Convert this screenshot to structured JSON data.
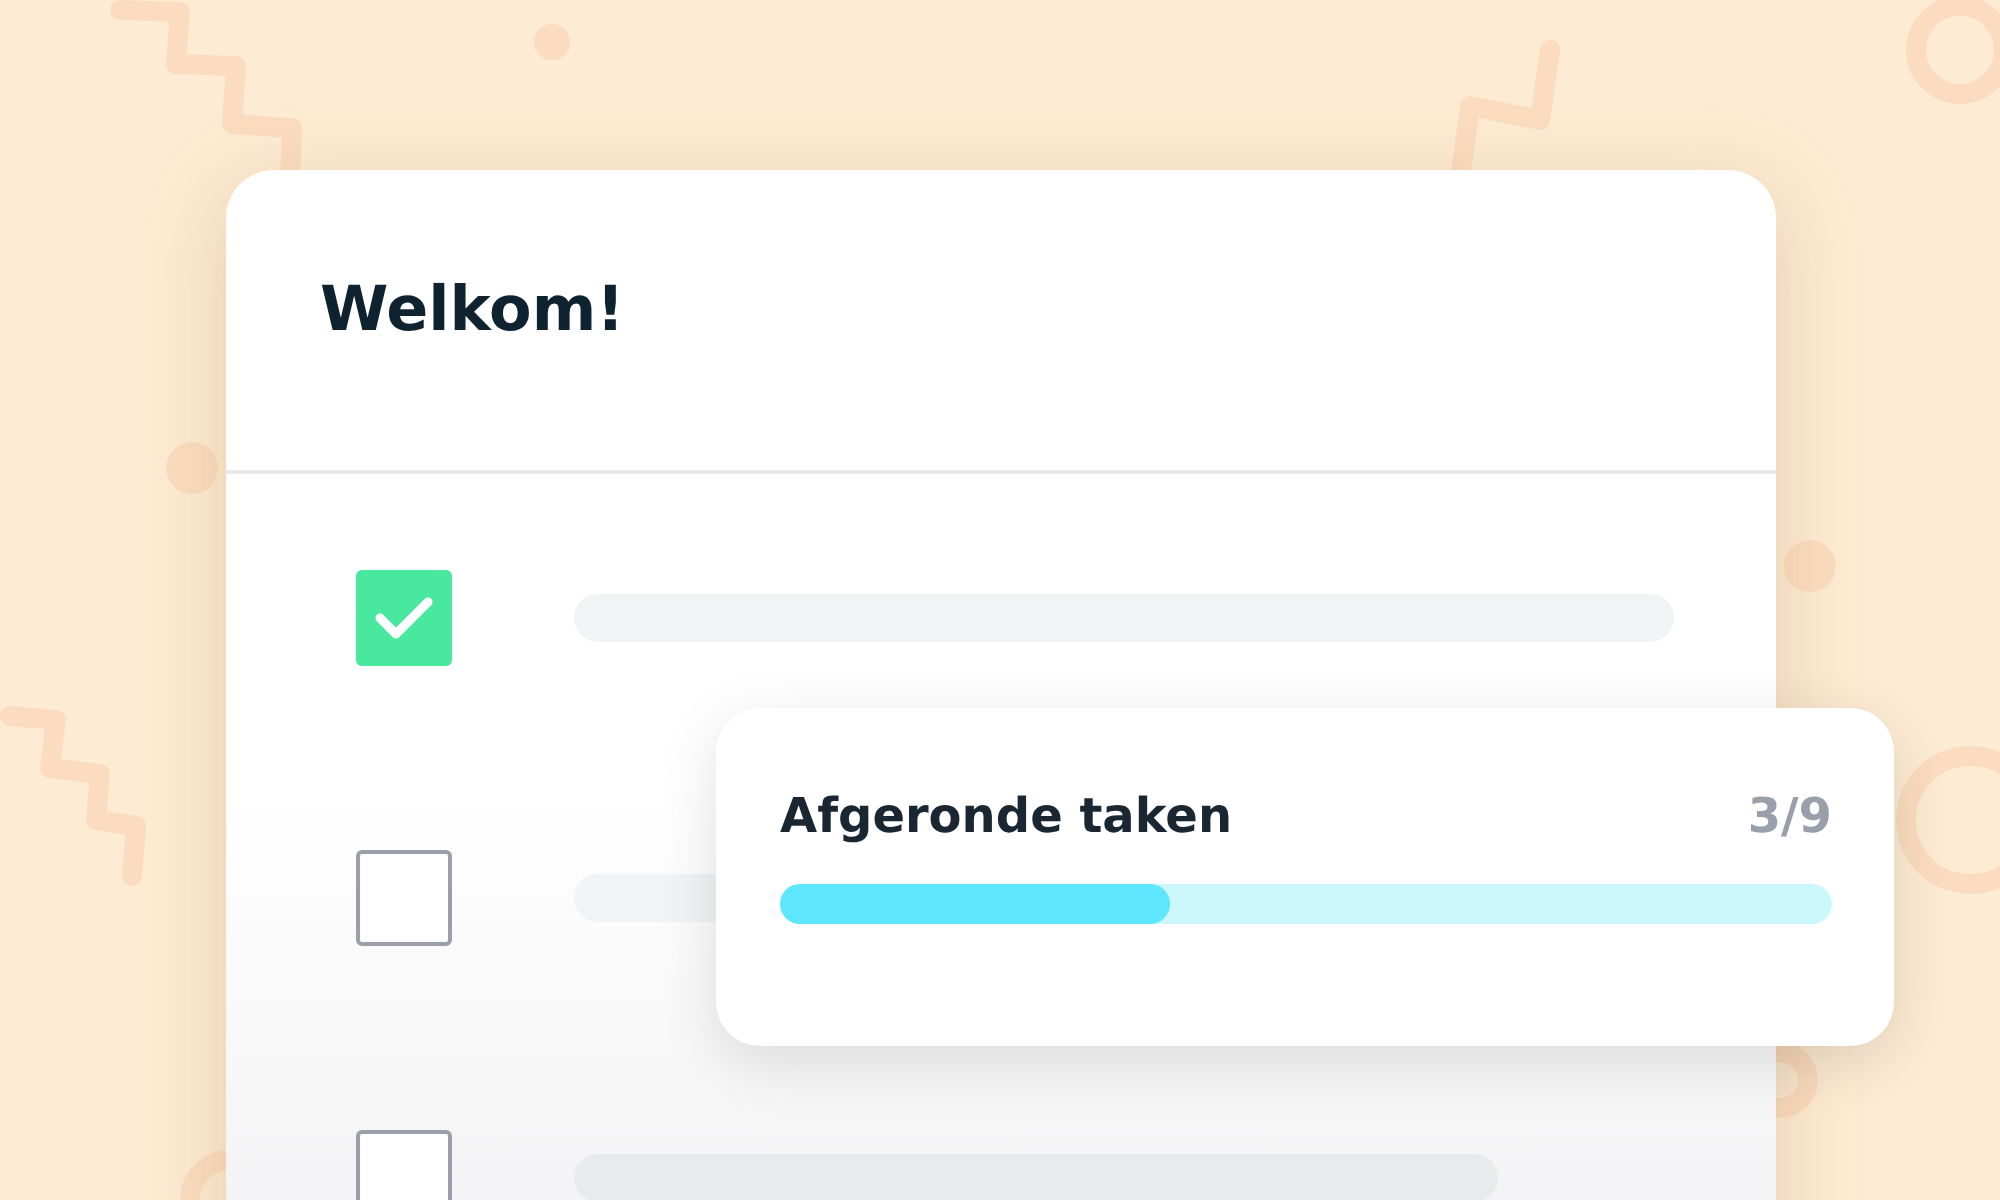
{
  "card": {
    "title": "Welkom!"
  },
  "tasks": [
    {
      "checked": true
    },
    {
      "checked": false
    },
    {
      "checked": false
    }
  ],
  "progress": {
    "label": "Afgeronde taken",
    "count": "3/9",
    "level": 0.37
  }
}
